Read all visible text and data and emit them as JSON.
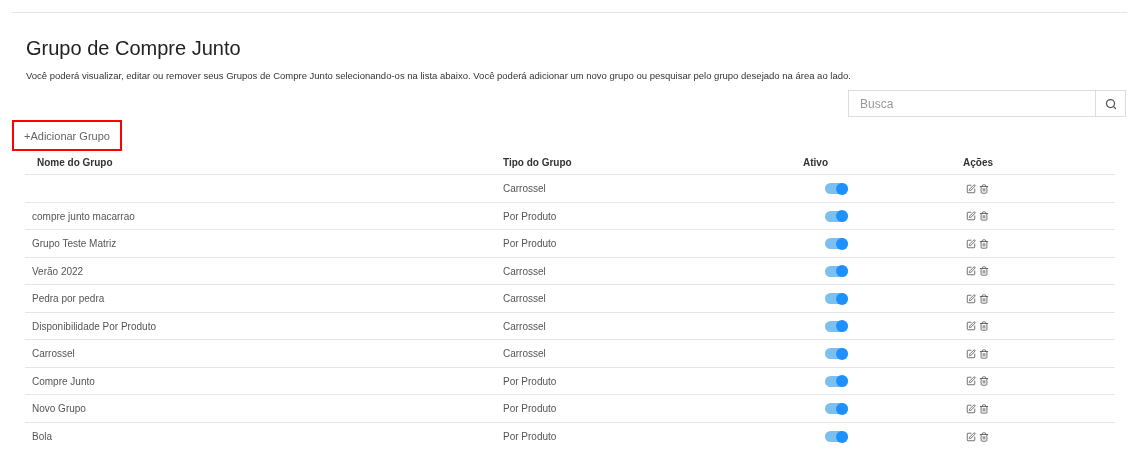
{
  "title": "Grupo de Compre Junto",
  "description": "Você poderá visualizar, editar ou remover seus Grupos de Compre Junto selecionando-os na lista abaixo. Você poderá adicionar um novo grupo ou pesquisar pelo grupo desejado na área ao lado.",
  "search": {
    "placeholder": "Busca"
  },
  "add_button": {
    "label": "+Adicionar Grupo",
    "highlighted": true
  },
  "table": {
    "columns": [
      "Nome do Grupo",
      "Tipo do Grupo",
      "Ativo",
      "Ações"
    ],
    "rows": [
      {
        "type": "Carrossel",
        "on": true
      },
      {
        "name": "compre junto macarrao",
        "type": "Por Produto",
        "on": true
      },
      {
        "name": "Grupo Teste Matriz",
        "type": "Por Produto",
        "on": true
      },
      {
        "name": "Verão 2022",
        "type": "Carrossel",
        "on": true
      },
      {
        "name": "Pedra por pedra",
        "type": "Carrossel",
        "on": true
      },
      {
        "name": "Disponibilidade Por Produto",
        "type": "Carrossel",
        "on": true
      },
      {
        "name": "Carrossel",
        "type": "Carrossel",
        "on": true
      },
      {
        "name": "Compre Junto",
        "type": "Por Produto",
        "on": true
      },
      {
        "name": "Novo Grupo",
        "type": "Por Produto",
        "on": true
      },
      {
        "name": "Bola",
        "type": "Por Produto",
        "on": true
      }
    ]
  }
}
